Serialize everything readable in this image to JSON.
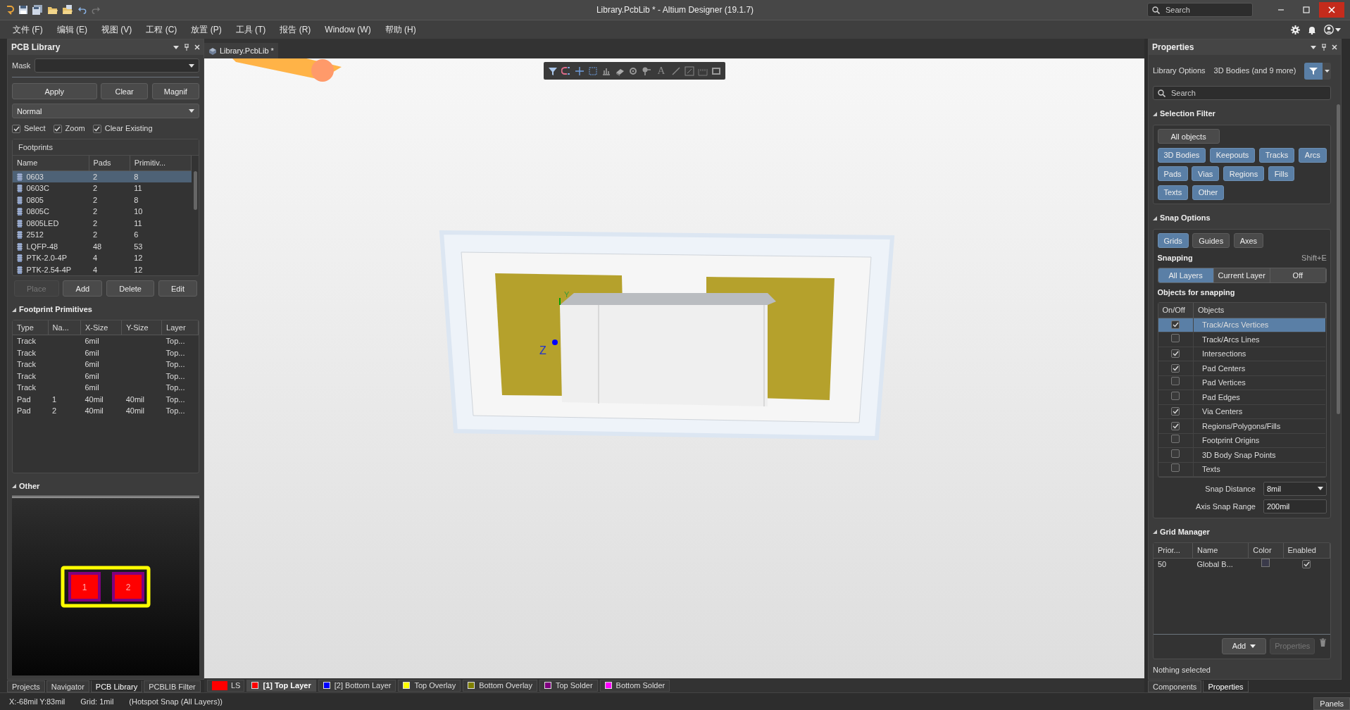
{
  "window": {
    "title": "Library.PcbLib * - Altium Designer (19.1.7)",
    "search_placeholder": "Search"
  },
  "menu": [
    "文件 (F)",
    "编辑 (E)",
    "视图 (V)",
    "工程 (C)",
    "放置 (P)",
    "工具 (T)",
    "报告 (R)",
    "Window (W)",
    "帮助 (H)"
  ],
  "left_panel": {
    "title": "PCB Library",
    "mask_label": "Mask",
    "buttons": [
      "Apply",
      "Clear",
      "Magnif"
    ],
    "mode": "Normal",
    "options": [
      {
        "label": "Select",
        "checked": true
      },
      {
        "label": "Zoom",
        "checked": true
      },
      {
        "label": "Clear Existing",
        "checked": true
      }
    ],
    "footprints": {
      "title": "Footprints",
      "columns": [
        "Name",
        "Pads",
        "Primitiv..."
      ],
      "rows": [
        {
          "name": "0603",
          "pads": "2",
          "primitives": "8",
          "selected": true
        },
        {
          "name": "0603C",
          "pads": "2",
          "primitives": "11",
          "selected": false
        },
        {
          "name": "0805",
          "pads": "2",
          "primitives": "8",
          "selected": false
        },
        {
          "name": "0805C",
          "pads": "2",
          "primitives": "10",
          "selected": false
        },
        {
          "name": "0805LED",
          "pads": "2",
          "primitives": "11",
          "selected": false
        },
        {
          "name": "2512",
          "pads": "2",
          "primitives": "6",
          "selected": false
        },
        {
          "name": "LQFP-48",
          "pads": "48",
          "primitives": "53",
          "selected": false
        },
        {
          "name": "PTK-2.0-4P",
          "pads": "4",
          "primitives": "12",
          "selected": false
        },
        {
          "name": "PTK-2.54-4P",
          "pads": "4",
          "primitives": "12",
          "selected": false
        }
      ]
    },
    "actions": [
      {
        "label": "Place",
        "disabled": true
      },
      {
        "label": "Add",
        "disabled": false
      },
      {
        "label": "Delete",
        "disabled": false
      },
      {
        "label": "Edit",
        "disabled": false
      }
    ],
    "primitives": {
      "title": "Footprint Primitives",
      "columns": [
        "Type",
        "Na...",
        "X-Size",
        "Y-Size",
        "Layer"
      ],
      "rows": [
        [
          "Track",
          "",
          "6mil",
          "",
          "Top..."
        ],
        [
          "Track",
          "",
          "6mil",
          "",
          "Top..."
        ],
        [
          "Track",
          "",
          "6mil",
          "",
          "Top..."
        ],
        [
          "Track",
          "",
          "6mil",
          "",
          "Top..."
        ],
        [
          "Track",
          "",
          "6mil",
          "",
          "Top..."
        ],
        [
          "Pad",
          "1",
          "40mil",
          "40mil",
          "Top..."
        ],
        [
          "Pad",
          "2",
          "40mil",
          "40mil",
          "Top..."
        ]
      ]
    },
    "other": {
      "title": "Other",
      "pads": [
        "1",
        "2"
      ]
    },
    "tabs": [
      {
        "label": "Projects",
        "selected": false
      },
      {
        "label": "Navigator",
        "selected": false
      },
      {
        "label": "PCB Library",
        "selected": true
      },
      {
        "label": "PCBLIB Filter",
        "selected": false
      }
    ]
  },
  "document_tab": {
    "label": "Library.PcbLib *"
  },
  "canvas": {
    "toolbar_letter": "A",
    "axis_labels": [
      "Y",
      "Z"
    ]
  },
  "layers": {
    "current": "LS",
    "items": [
      {
        "label": "[1] Top Layer",
        "color": "#ff0000",
        "selected": true
      },
      {
        "label": "[2] Bottom Layer",
        "color": "#0000ff",
        "selected": false
      },
      {
        "label": "Top Overlay",
        "color": "#ffff00",
        "selected": false
      },
      {
        "label": "Bottom Overlay",
        "color": "#808000",
        "selected": false
      },
      {
        "label": "Top Solder",
        "color": "#800080",
        "selected": false
      },
      {
        "label": "Bottom Solder",
        "color": "#ff00ff",
        "selected": false
      }
    ]
  },
  "right_panel": {
    "title": "Properties",
    "library_options": "Library Options",
    "filter_summary": "3D Bodies (and 9 more)",
    "search_placeholder": "Search",
    "selection_filter": {
      "title": "Selection Filter",
      "all_label": "All objects",
      "items": [
        {
          "label": "3D Bodies",
          "on": true
        },
        {
          "label": "Keepouts",
          "on": true
        },
        {
          "label": "Tracks",
          "on": true
        },
        {
          "label": "Arcs",
          "on": true
        },
        {
          "label": "Pads",
          "on": true
        },
        {
          "label": "Vias",
          "on": true
        },
        {
          "label": "Regions",
          "on": true
        },
        {
          "label": "Fills",
          "on": true
        },
        {
          "label": "Texts",
          "on": true
        },
        {
          "label": "Other",
          "on": true
        }
      ]
    },
    "snap_options": {
      "title": "Snap Options",
      "modes": [
        {
          "label": "Grids",
          "on": true
        },
        {
          "label": "Guides",
          "on": false
        },
        {
          "label": "Axes",
          "on": false
        }
      ],
      "snapping_label": "Snapping",
      "shortcut": "Shift+E",
      "snapping": [
        {
          "label": "All Layers",
          "selected": true
        },
        {
          "label": "Current Layer",
          "selected": false
        },
        {
          "label": "Off",
          "selected": false
        }
      ],
      "objects_title": "Objects for snapping",
      "columns": [
        "On/Off",
        "Objects"
      ],
      "objects": [
        {
          "label": "Track/Arcs Vertices",
          "checked": true,
          "selected": true
        },
        {
          "label": "Track/Arcs Lines",
          "checked": false,
          "selected": false
        },
        {
          "label": "Intersections",
          "checked": true,
          "selected": false
        },
        {
          "label": "Pad Centers",
          "checked": true,
          "selected": false
        },
        {
          "label": "Pad Vertices",
          "checked": false,
          "selected": false
        },
        {
          "label": "Pad Edges",
          "checked": false,
          "selected": false
        },
        {
          "label": "Via Centers",
          "checked": true,
          "selected": false
        },
        {
          "label": "Regions/Polygons/Fills",
          "checked": true,
          "selected": false
        },
        {
          "label": "Footprint Origins",
          "checked": false,
          "selected": false
        },
        {
          "label": "3D Body Snap Points",
          "checked": false,
          "selected": false
        },
        {
          "label": "Texts",
          "checked": false,
          "selected": false
        }
      ],
      "snap_distance_label": "Snap Distance",
      "snap_distance": "8mil",
      "axis_range_label": "Axis Snap Range",
      "axis_range": "200mil"
    },
    "grid_manager": {
      "title": "Grid Manager",
      "columns": [
        "Prior...",
        "Name",
        "Color",
        "Enabled"
      ],
      "rows": [
        {
          "priority": "50",
          "name": "Global B...",
          "enabled": true
        }
      ],
      "add_label": "Add",
      "properties_label": "Properties"
    },
    "status": "Nothing selected",
    "tabs": [
      {
        "label": "Components",
        "selected": false
      },
      {
        "label": "Properties",
        "selected": true
      }
    ]
  },
  "status_bar": {
    "coords": "X:-68mil Y:83mil",
    "grid": "Grid: 1mil",
    "snap": "(Hotspot Snap (All Layers))",
    "panels_label": "Panels"
  }
}
